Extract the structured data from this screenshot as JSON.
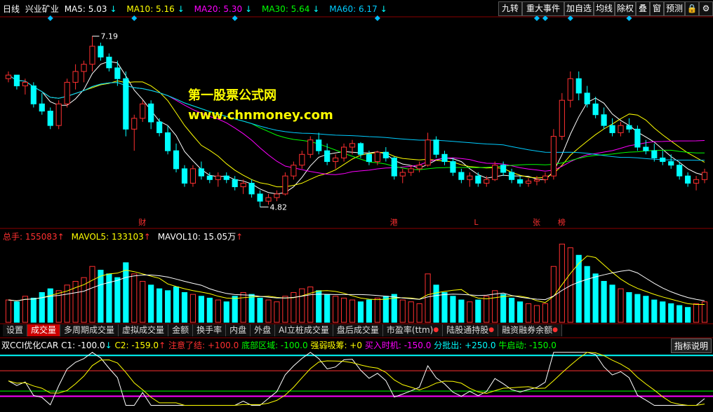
{
  "header": {
    "period": "日线",
    "stock": "兴业矿业",
    "ma5": "MA5: 5.03",
    "ma10": "MA10: 5.16",
    "ma20": "MA20: 5.30",
    "ma30": "MA30: 5.64",
    "ma60": "MA60: 6.17",
    "arrow": "↓"
  },
  "toolbar": [
    "九转",
    "重大事件",
    "加自选",
    "均线",
    "除权",
    "叠",
    "窗",
    "预测"
  ],
  "watermark": {
    "line1": "第一股票公式网",
    "line2": "www.chnmoney.com"
  },
  "price_labels": {
    "high": "7.19",
    "low": "4.82"
  },
  "event_labels": [
    "财",
    "港",
    "L",
    "张",
    "榜"
  ],
  "volume_header": {
    "total": "总手: 155083",
    "mavol5": "MAVOL5: 133103",
    "mavol10": "MAVOL10: 15.05万",
    "arrow": "↑"
  },
  "tabs": [
    "设置",
    "成交量",
    "多周期成交量",
    "虚拟成交量",
    "金额",
    "换手率",
    "内盘",
    "外盘",
    "AI立桩成交量",
    "盘后成交量",
    "市盈率(ttm)",
    "陆股通持股",
    "融资融券余额"
  ],
  "indicator_header": {
    "name": "双CCI优化CAR",
    "c1": "C1: -100.0",
    "c2": "C2: -159.0",
    "attention": "注意了结: +100.0",
    "bottom": "底部区域: -100.0",
    "strong": "强弱吸筹: +0",
    "buy": "买入时机: -150.0",
    "sell": "分批出: +250.0",
    "bull": "牛启动: -150.0"
  },
  "indicator_button": "指标说明",
  "colors": {
    "up": "#ff3030",
    "down": "#00ffff",
    "ma5": "#ffffff",
    "ma10": "#ffff00",
    "ma20": "#ff00ff",
    "ma30": "#00ff00",
    "ma60": "#00ccff"
  },
  "chart_data": {
    "type": "candlestick",
    "price_ylim": [
      4.6,
      7.4
    ],
    "candles": [
      [
        6.6,
        6.7,
        6.55,
        6.65
      ],
      [
        6.65,
        6.62,
        6.45,
        6.5
      ],
      [
        6.5,
        6.6,
        6.38,
        6.55
      ],
      [
        6.5,
        6.55,
        6.2,
        6.25
      ],
      [
        6.25,
        6.4,
        6.1,
        6.15
      ],
      [
        6.15,
        6.2,
        5.9,
        5.95
      ],
      [
        5.95,
        6.3,
        5.9,
        6.25
      ],
      [
        6.25,
        6.6,
        6.2,
        6.55
      ],
      [
        6.55,
        6.8,
        6.45,
        6.7
      ],
      [
        6.7,
        6.85,
        6.55,
        6.8
      ],
      [
        6.8,
        7.19,
        6.7,
        7.05
      ],
      [
        7.05,
        7.1,
        6.85,
        6.9
      ],
      [
        6.9,
        6.95,
        6.7,
        6.75
      ],
      [
        6.75,
        6.85,
        6.5,
        6.6
      ],
      [
        6.6,
        6.7,
        5.8,
        5.9
      ],
      [
        5.9,
        6.1,
        5.6,
        6.05
      ],
      [
        6.05,
        6.3,
        6.0,
        6.25
      ],
      [
        6.25,
        6.3,
        5.9,
        6.0
      ],
      [
        6.0,
        6.05,
        5.8,
        5.85
      ],
      [
        5.85,
        5.95,
        5.55,
        5.6
      ],
      [
        5.6,
        5.7,
        5.3,
        5.35
      ],
      [
        5.35,
        5.4,
        5.1,
        5.15
      ],
      [
        5.15,
        5.4,
        5.1,
        5.35
      ],
      [
        5.35,
        5.45,
        5.2,
        5.25
      ],
      [
        5.25,
        5.3,
        5.15,
        5.2
      ],
      [
        5.2,
        5.3,
        5.1,
        5.25
      ],
      [
        5.25,
        5.3,
        5.15,
        5.2
      ],
      [
        5.2,
        5.25,
        5.05,
        5.1
      ],
      [
        5.1,
        5.2,
        5.0,
        5.15
      ],
      [
        5.15,
        5.2,
        4.95,
        5.0
      ],
      [
        5.0,
        5.05,
        4.82,
        4.9
      ],
      [
        4.9,
        5.0,
        4.85,
        4.95
      ],
      [
        4.95,
        5.05,
        4.9,
        5.0
      ],
      [
        5.0,
        5.3,
        4.98,
        5.25
      ],
      [
        5.25,
        5.45,
        5.2,
        5.4
      ],
      [
        5.4,
        5.6,
        5.35,
        5.55
      ],
      [
        5.55,
        5.8,
        5.5,
        5.75
      ],
      [
        5.75,
        5.85,
        5.55,
        5.6
      ],
      [
        5.6,
        5.7,
        5.4,
        5.45
      ],
      [
        5.45,
        5.55,
        5.35,
        5.5
      ],
      [
        5.5,
        5.7,
        5.45,
        5.65
      ],
      [
        5.65,
        5.75,
        5.55,
        5.7
      ],
      [
        5.7,
        5.72,
        5.5,
        5.55
      ],
      [
        5.55,
        5.6,
        5.4,
        5.45
      ],
      [
        5.45,
        5.6,
        5.4,
        5.58
      ],
      [
        5.58,
        5.65,
        5.45,
        5.5
      ],
      [
        5.5,
        5.52,
        5.2,
        5.25
      ],
      [
        5.25,
        5.35,
        5.15,
        5.3
      ],
      [
        5.3,
        5.4,
        5.25,
        5.35
      ],
      [
        5.35,
        5.45,
        5.3,
        5.4
      ],
      [
        5.4,
        5.85,
        5.38,
        5.75
      ],
      [
        5.75,
        5.8,
        5.5,
        5.55
      ],
      [
        5.55,
        5.6,
        5.4,
        5.45
      ],
      [
        5.45,
        5.5,
        5.25,
        5.3
      ],
      [
        5.3,
        5.35,
        5.15,
        5.2
      ],
      [
        5.2,
        5.3,
        5.1,
        5.25
      ],
      [
        5.25,
        5.3,
        5.1,
        5.15
      ],
      [
        5.15,
        5.25,
        5.1,
        5.2
      ],
      [
        5.2,
        5.45,
        5.18,
        5.4
      ],
      [
        5.4,
        5.45,
        5.25,
        5.3
      ],
      [
        5.3,
        5.35,
        5.15,
        5.2
      ],
      [
        5.2,
        5.25,
        5.1,
        5.15
      ],
      [
        5.15,
        5.22,
        5.1,
        5.18
      ],
      [
        5.18,
        5.25,
        5.12,
        5.2
      ],
      [
        5.2,
        5.3,
        5.15,
        5.25
      ],
      [
        5.25,
        5.9,
        5.2,
        5.8
      ],
      [
        5.8,
        6.4,
        5.75,
        6.3
      ],
      [
        6.3,
        6.7,
        6.2,
        6.6
      ],
      [
        6.6,
        6.7,
        6.3,
        6.4
      ],
      [
        6.4,
        6.5,
        6.2,
        6.25
      ],
      [
        6.25,
        6.35,
        6.05,
        6.1
      ],
      [
        6.1,
        6.2,
        5.9,
        5.95
      ],
      [
        5.95,
        6.05,
        5.8,
        5.85
      ],
      [
        5.85,
        6.0,
        5.8,
        5.95
      ],
      [
        5.95,
        6.05,
        5.85,
        5.9
      ],
      [
        5.9,
        5.95,
        5.6,
        5.65
      ],
      [
        5.65,
        5.75,
        5.55,
        5.6
      ],
      [
        5.6,
        5.7,
        5.45,
        5.5
      ],
      [
        5.5,
        5.6,
        5.4,
        5.45
      ],
      [
        5.45,
        5.55,
        5.35,
        5.4
      ],
      [
        5.4,
        5.45,
        5.2,
        5.25
      ],
      [
        5.25,
        5.3,
        5.1,
        5.15
      ],
      [
        5.15,
        5.25,
        5.05,
        5.2
      ],
      [
        5.2,
        5.35,
        5.15,
        5.3
      ]
    ],
    "volume_ylim": [
      0,
      220000
    ],
    "volume": [
      60,
      55,
      70,
      65,
      80,
      90,
      85,
      100,
      110,
      120,
      150,
      140,
      130,
      120,
      160,
      130,
      110,
      100,
      90,
      85,
      95,
      80,
      75,
      70,
      65,
      60,
      55,
      70,
      80,
      75,
      65,
      60,
      55,
      70,
      80,
      90,
      95,
      85,
      75,
      70,
      65,
      60,
      55,
      60,
      65,
      70,
      75,
      60,
      55,
      50,
      130,
      100,
      80,
      70,
      60,
      55,
      60,
      70,
      85,
      75,
      65,
      55,
      50,
      45,
      50,
      150,
      210,
      200,
      180,
      150,
      130,
      110,
      100,
      90,
      80,
      75,
      70,
      60,
      55,
      50,
      45,
      40,
      50,
      55
    ],
    "cci": {
      "ylim": [
        -250,
        300
      ]
    }
  }
}
